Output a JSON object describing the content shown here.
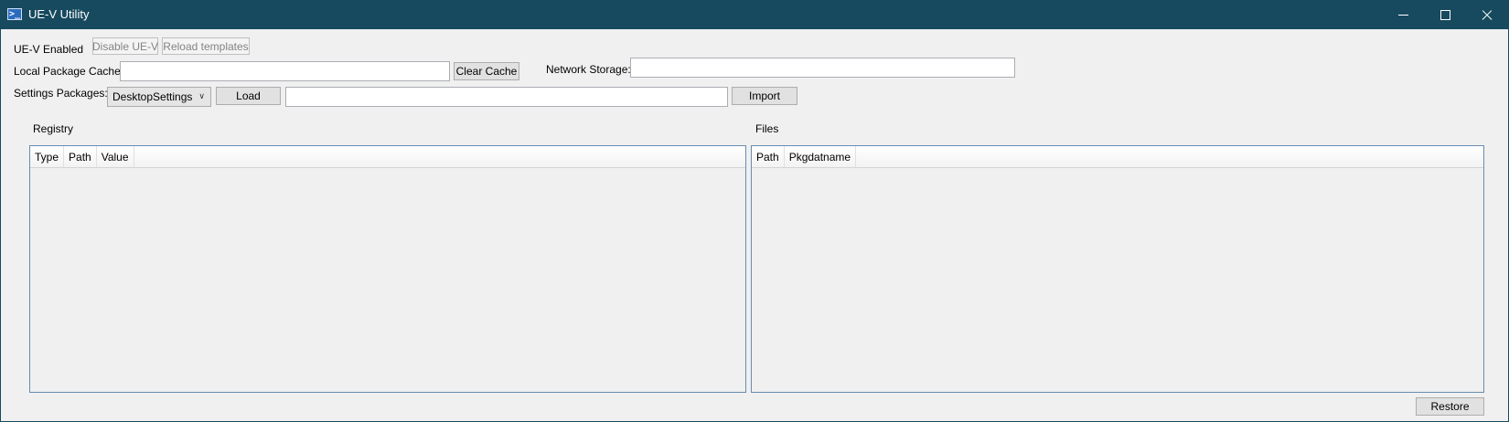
{
  "window": {
    "title": "UE-V Utility"
  },
  "status": {
    "label": "UE-V Enabled"
  },
  "buttons": {
    "disable": "Disable UE-V",
    "reload": "Reload templates",
    "clear_cache": "Clear Cache",
    "load": "Load",
    "import": "Import",
    "restore": "Restore"
  },
  "fields": {
    "local_cache_label": "Local Package Cache:",
    "local_cache_value": "",
    "network_storage_label": "Network Storage:",
    "network_storage_value": "",
    "settings_packages_label": "Settings Packages:",
    "settings_packages_selected": "DesktopSettings",
    "import_path_value": ""
  },
  "registry": {
    "title": "Registry",
    "columns": [
      "Type",
      "Path",
      "Value"
    ],
    "rows": []
  },
  "files": {
    "title": "Files",
    "columns": [
      "Path",
      "Pkgdatname"
    ],
    "rows": []
  },
  "icons": {
    "app": "powershell-icon",
    "minimize": "minimize-icon",
    "maximize": "maximize-icon",
    "close": "close-icon",
    "dropdown": "chevron-down-icon"
  },
  "colors": {
    "titlebar": "#174a5f",
    "grid_border": "#688caf",
    "window_bg": "#f0f0f0"
  }
}
